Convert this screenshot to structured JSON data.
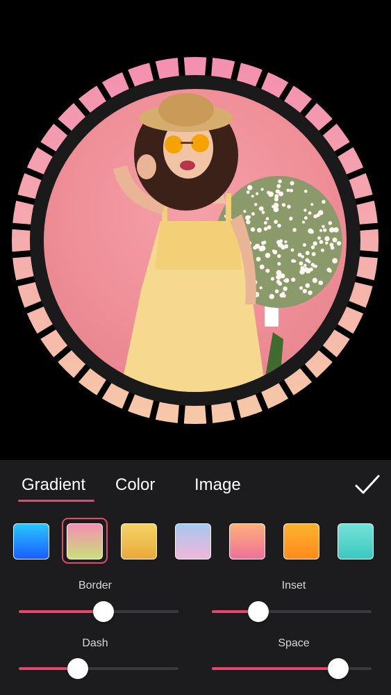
{
  "tabs": [
    {
      "label": "Gradient",
      "active": true
    },
    {
      "label": "Color",
      "active": false
    },
    {
      "label": "Image",
      "active": false
    }
  ],
  "accent_color": "#e8476a",
  "frame": {
    "style": "dashed-ring",
    "gradient_top": "#f48fb1",
    "gradient_bottom": "#f6c9a8"
  },
  "swatches": [
    {
      "name": "blue",
      "colors": [
        "#29c5ff",
        "#1a5cff"
      ],
      "selected": false
    },
    {
      "name": "pink-green",
      "colors": [
        "#f48fb1",
        "#c8e07a"
      ],
      "selected": true
    },
    {
      "name": "yellow",
      "colors": [
        "#f6d365",
        "#e9a93c"
      ],
      "selected": false
    },
    {
      "name": "pastel",
      "colors": [
        "#a6c8f0",
        "#f0b6d8"
      ],
      "selected": false
    },
    {
      "name": "peach-pink",
      "colors": [
        "#fdb07a",
        "#f0709a"
      ],
      "selected": false
    },
    {
      "name": "orange",
      "colors": [
        "#ffb22e",
        "#ff8a1c"
      ],
      "selected": false
    },
    {
      "name": "mint",
      "colors": [
        "#73e3d8",
        "#3cc8c0"
      ],
      "selected": false
    }
  ],
  "sliders": [
    {
      "label": "Border",
      "value": 0.53
    },
    {
      "label": "Inset",
      "value": 0.29
    },
    {
      "label": "Dash",
      "value": 0.37
    },
    {
      "label": "Space",
      "value": 0.79
    }
  ],
  "icons": {
    "confirm": "checkmark-icon"
  }
}
